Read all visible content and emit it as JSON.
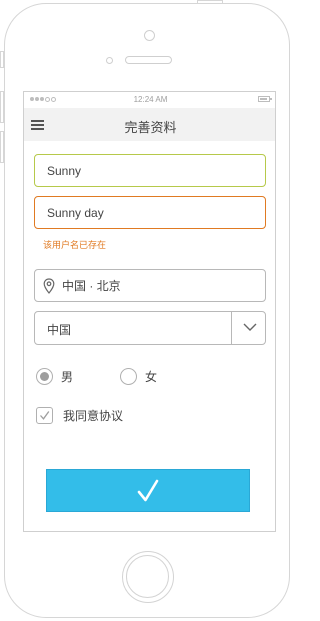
{
  "status_bar": {
    "time": "12:24 AM"
  },
  "nav": {
    "title": "完善资料",
    "menu_icon": "hamburger-menu-icon"
  },
  "form": {
    "nickname": {
      "value": "Sunny"
    },
    "username": {
      "value": "Sunny day",
      "error": "该用户名已存在"
    },
    "location": {
      "value": "中国 · 北京",
      "icon": "location-pin-icon"
    },
    "country_select": {
      "value": "中国",
      "icon": "chevron-down-icon"
    },
    "gender": {
      "options": [
        "男",
        "女"
      ],
      "selected": "男"
    },
    "agreement": {
      "label": "我同意协议",
      "checked": true
    },
    "submit": {
      "icon": "checkmark-icon"
    }
  },
  "colors": {
    "accent": "#33bde9",
    "error": "#e07a22",
    "valid_border": "#b6c94a",
    "nav_bg": "#f2f2f2"
  }
}
